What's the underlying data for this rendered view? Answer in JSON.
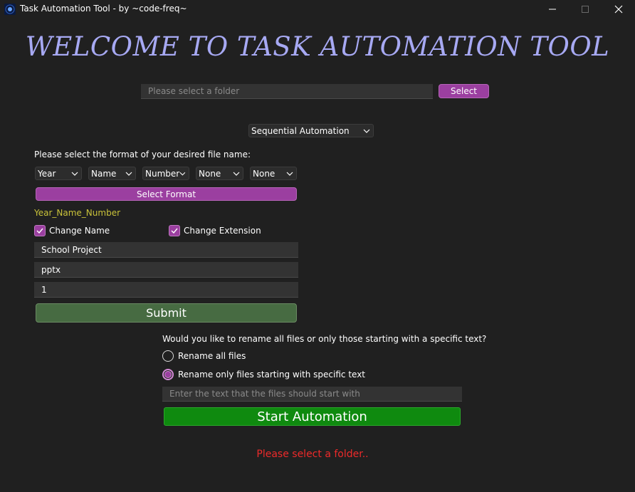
{
  "window": {
    "title": "Task Automation Tool - by ~code-freq~",
    "controls": [
      "minimize-icon",
      "maximize-icon",
      "close-icon"
    ]
  },
  "heading": "WELCOME TO TASK AUTOMATION TOOL",
  "folder": {
    "placeholder": "Please select a folder",
    "button_label": "Select"
  },
  "mode_select": {
    "selected": "Sequential Automation"
  },
  "format": {
    "prompt": "Please select the format of your desired file name:",
    "parts": [
      "Year",
      "Name",
      "Number",
      "None",
      "None"
    ],
    "button_label": "Select Format",
    "preview": "Year_Name_Number"
  },
  "options": {
    "change_name": {
      "label": "Change Name",
      "checked": true
    },
    "change_extension": {
      "label": "Change Extension",
      "checked": true
    }
  },
  "inputs": {
    "name": "School Project",
    "extension": "pptx",
    "start_number": "1"
  },
  "submit_label": "Submit",
  "rename_scope": {
    "question": "Would you like to rename all files or only those starting with a specific text?",
    "options": [
      "Rename all files",
      "Rename only files starting with specific text"
    ],
    "selected_index": 1,
    "text_placeholder": "Enter the text that the files should start with"
  },
  "start_label": "Start Automation",
  "status_message": "Please select a folder..",
  "colors": {
    "background": "#202020",
    "heading": "#a7a9f3",
    "accent_purple": "#9b3fa0",
    "submit_green": "#476b42",
    "start_green": "#0f8a0f",
    "preview_text": "#c9c23a",
    "error_text": "#ee2a2a"
  }
}
